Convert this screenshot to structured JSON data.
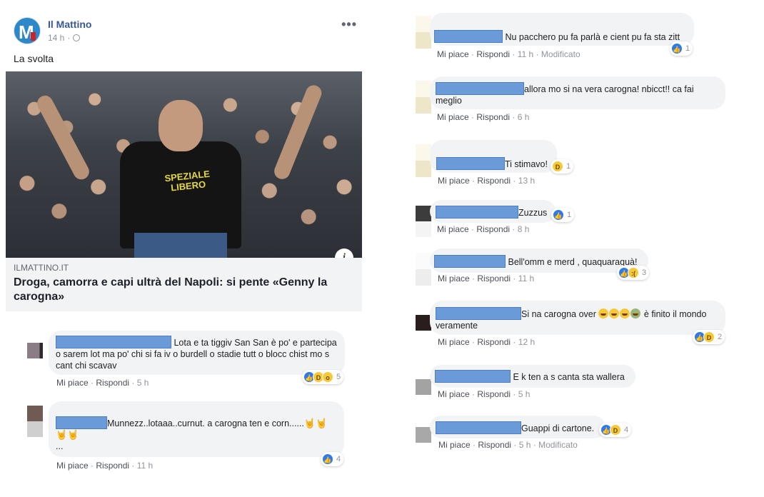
{
  "post": {
    "page_name": "Il Mattino",
    "time": "14 h",
    "text": "La svolta",
    "link": {
      "source": "ILMATTINO.IT",
      "title": "Droga, camorra e capi ultrà del Napoli: si pente «Genny la carogna»",
      "shirt_text": "SPEZIALE LIBERO"
    }
  },
  "labels": {
    "like": "Mi piace",
    "reply": "Rispondi",
    "edited": "Modificato",
    "sep": "·"
  },
  "left_comments": [
    {
      "text": "Lota e ta tiggiv San San è po' e partecipa o sarem lot ma po' chi si fa iv o burdell o stadie tutt o blocc chist mo s cant chi scavav",
      "time": "5 h",
      "reactions": "5"
    },
    {
      "text": "Munnezz..lotaaa..curnut. a carogna ten e corn......",
      "text_line2": "...",
      "time": "11 h",
      "reactions": "4"
    }
  ],
  "right_comments": [
    {
      "text": "Nu pacchero pu fa parlà e cient pu fa sta zitt",
      "time": "11 h",
      "edited": true,
      "reactions": "1"
    },
    {
      "text": "allora mo si na vera carogna! nbicct!! ca fai meglio",
      "time": "6 h"
    },
    {
      "text": "Ti stimavo!",
      "time": "13 h",
      "reactions": "1"
    },
    {
      "text": "Zuzzus",
      "time": "8 h",
      "reactions": "1"
    },
    {
      "text": "Bell'omm e merd , quaquaraquà!",
      "time": "11 h",
      "reactions": "3"
    },
    {
      "text": "Si na carogna over",
      "text_after": "è finito il mondo veramente",
      "time": "12 h",
      "reactions": "2"
    },
    {
      "text": "E k ten a s canta sta wallera",
      "time": "5 h"
    },
    {
      "text": "Guappi di cartone.",
      "time": "5 h",
      "edited": true,
      "reactions": "4"
    }
  ],
  "colors": {
    "link_blue": "#385898",
    "like_blue": "#2d7af0",
    "bubble": "#f2f3f5",
    "redaction": "#6a9bd8"
  },
  "icons": [
    "globe-icon",
    "more-icon",
    "info-icon",
    "like-icon",
    "haha-icon",
    "wow-icon",
    "sad-icon",
    "horns-emoji"
  ]
}
